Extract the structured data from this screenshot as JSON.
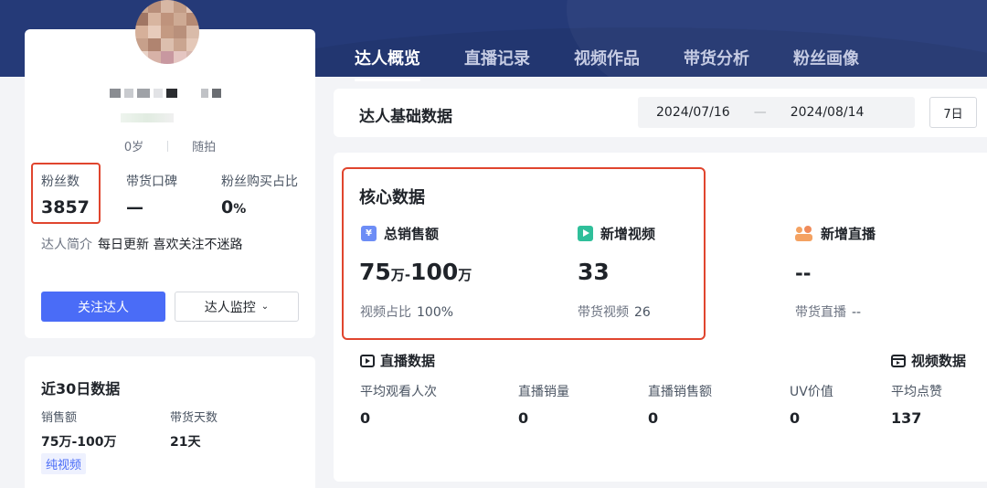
{
  "nav": {
    "tabs": [
      "达人概览",
      "直播记录",
      "视频作品",
      "带货分析",
      "粉丝画像"
    ],
    "active_index": 0
  },
  "profile": {
    "age": "0岁",
    "category": "随拍",
    "stats": [
      {
        "label": "粉丝数",
        "value": "3857"
      },
      {
        "label": "带货口碑",
        "value": "—"
      },
      {
        "label": "粉丝购买占比",
        "value": "0",
        "unit": "%"
      }
    ],
    "intro_label": "达人简介",
    "intro_text": "每日更新 喜欢关注不迷路",
    "follow_button": "关注达人",
    "monitor_button": "达人监控"
  },
  "last30": {
    "title": "近30日数据",
    "sales_label": "销售额",
    "sales_value": "75万-100万",
    "days_label": "带货天数",
    "days_value": "21天",
    "tag": "纯视频"
  },
  "basic": {
    "title": "达人基础数据",
    "date_start": "2024/07/16",
    "date_sep": "—",
    "date_end": "2024/08/14",
    "range_button": "7日"
  },
  "core": {
    "title": "核心数据",
    "metrics": [
      {
        "icon": "yen-icon",
        "label": "总销售额",
        "value_a": "75",
        "unit_a": "万",
        "sep": "-",
        "value_b": "100",
        "unit_b": "万",
        "sub_label": "视频占比",
        "sub_value": "100%"
      },
      {
        "icon": "video-icon",
        "label": "新增视频",
        "value": "33",
        "sub_label": "带货视频",
        "sub_value": "26"
      },
      {
        "icon": "live-icon",
        "label": "新增直播",
        "value": "--",
        "sub_label": "带货直播",
        "sub_value": "--"
      }
    ]
  },
  "live": {
    "title": "直播数据",
    "items": [
      {
        "label": "平均观看人次",
        "value": "0"
      },
      {
        "label": "直播销量",
        "value": "0"
      },
      {
        "label": "直播销售额",
        "value": "0"
      },
      {
        "label": "UV价值",
        "value": "0"
      }
    ]
  },
  "video": {
    "title": "视频数据",
    "items": [
      {
        "label": "平均点赞",
        "value": "137"
      }
    ]
  },
  "colors": {
    "brand_blue": "#4a6cf7",
    "header_navy": "#253a78",
    "highlight_red": "#e0452e"
  }
}
